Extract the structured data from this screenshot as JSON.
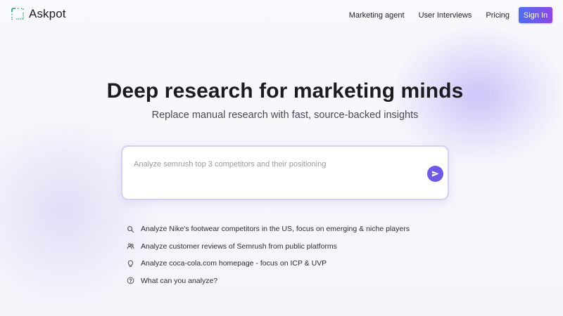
{
  "brand": {
    "name": "Askpot"
  },
  "nav": {
    "items": [
      {
        "label": "Marketing agent"
      },
      {
        "label": "User Interviews"
      },
      {
        "label": "Pricing"
      }
    ],
    "signin_label": "Sign In"
  },
  "hero": {
    "title": "Deep research for marketing minds",
    "subtitle": "Replace manual research with fast, source-backed insights"
  },
  "search": {
    "placeholder": "Analyze semrush top 3 competitors and their positioning",
    "value": "",
    "send_icon": "send-icon"
  },
  "suggestions": [
    {
      "icon": "search-icon",
      "label": "Analyze Nike's footwear competitors in the US, focus on emerging & niche players"
    },
    {
      "icon": "users-icon",
      "label": "Analyze customer reviews of Semrush from public platforms"
    },
    {
      "icon": "lightbulb-icon",
      "label": "Analyze coca-cola.com homepage - focus on ICP & UVP"
    },
    {
      "icon": "help-circle-icon",
      "label": "What can you analyze?"
    }
  ],
  "colors": {
    "accent": "#6c5ae6",
    "signin_gradient_start": "#4f6ef0",
    "signin_gradient_end": "#8b48e8",
    "logo": "#1aa063"
  }
}
